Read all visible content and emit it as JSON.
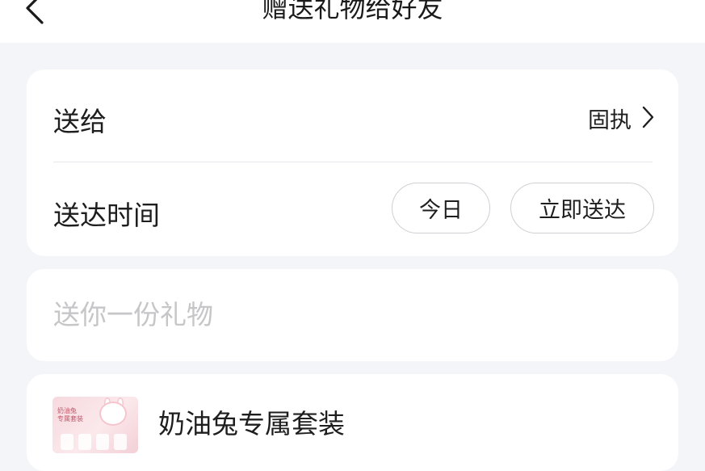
{
  "header": {
    "title": "赠送礼物给好友",
    "back_icon": "chevron-left-icon"
  },
  "recipient_card": {
    "send_to_label": "送给",
    "recipient_name": "固执",
    "recipient_chevron_icon": "chevron-right-icon",
    "delivery_time_label": "送达时间",
    "date_option": "今日",
    "timing_option": "立即送达"
  },
  "message_card": {
    "placeholder": "送你一份礼物"
  },
  "product_card": {
    "product_name": "奶油兔专属套装",
    "thumbnail_text_line1": "奶油兔",
    "thumbnail_text_line2": "专属套装"
  },
  "colors": {
    "page_background": "#f4f5f9",
    "card_background": "#ffffff",
    "pill_border": "#cfcfd4",
    "placeholder_text": "#c6c6c8"
  }
}
